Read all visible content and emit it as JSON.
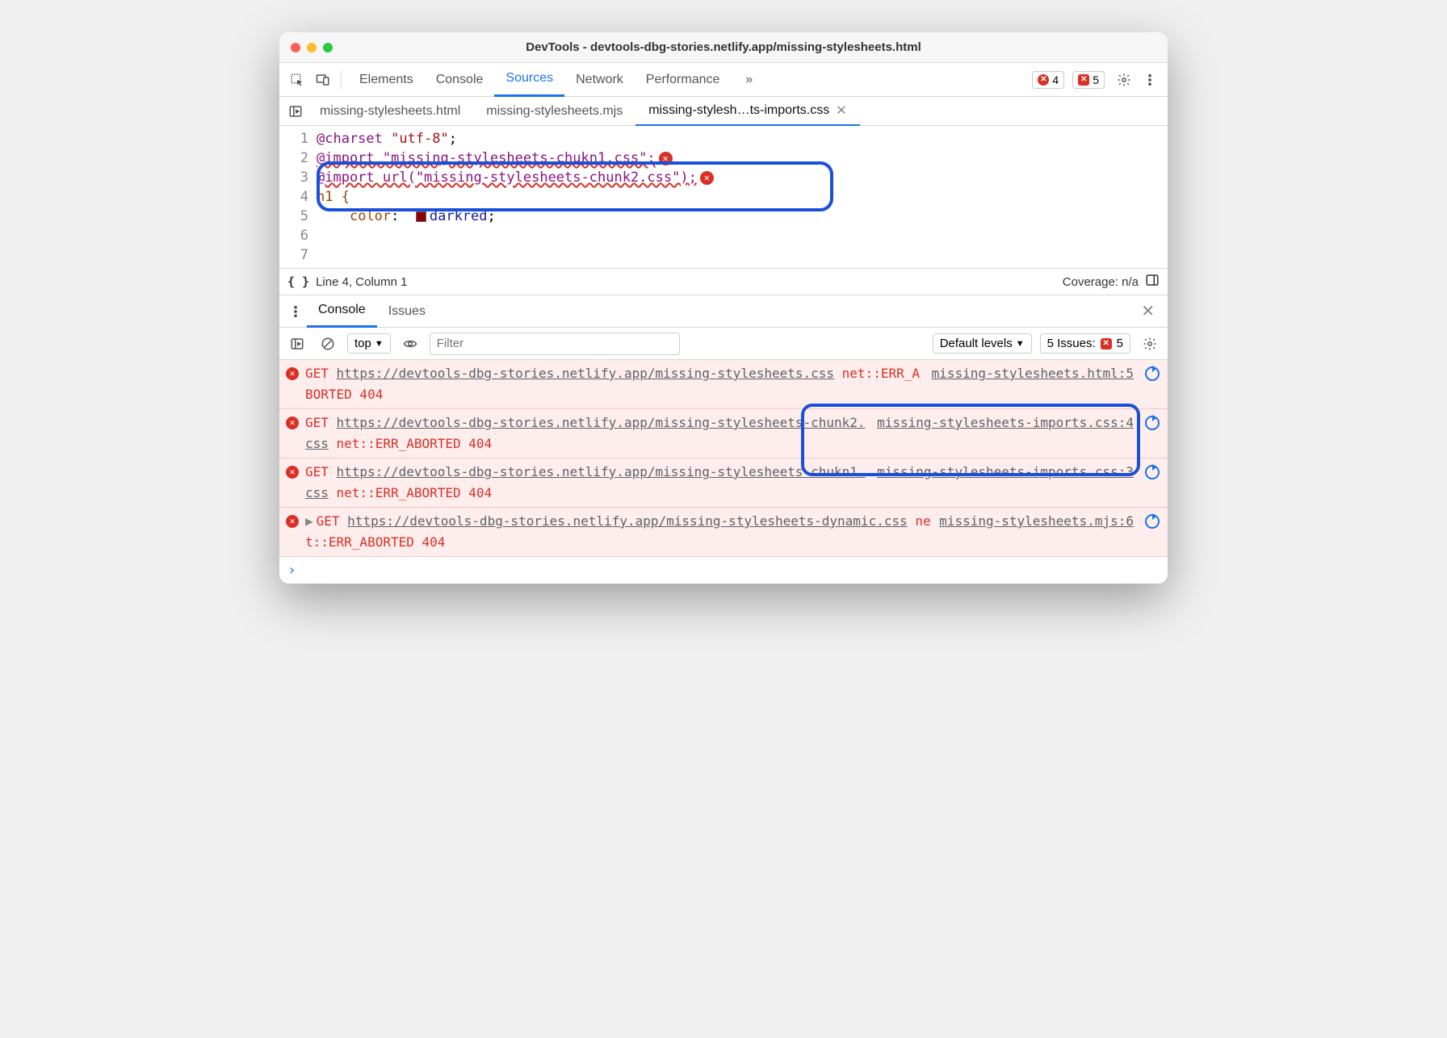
{
  "window": {
    "title": "DevTools - devtools-dbg-stories.netlify.app/missing-stylesheets.html"
  },
  "toolbar": {
    "tabs": [
      "Elements",
      "Console",
      "Sources",
      "Network",
      "Performance"
    ],
    "active_tab": "Sources",
    "more": "»",
    "error_count": "4",
    "warning_count": "5"
  },
  "file_tabs": {
    "tabs": [
      "missing-stylesheets.html",
      "missing-stylesheets.mjs",
      "missing-stylesh…ts-imports.css"
    ],
    "active": 2
  },
  "editor": {
    "lines": [
      {
        "n": "1",
        "segments": [
          {
            "t": "@charset ",
            "c": "kw"
          },
          {
            "t": "\"utf-8\"",
            "c": "str"
          },
          {
            "t": ";",
            "c": ""
          }
        ]
      },
      {
        "n": "2",
        "segments": []
      },
      {
        "n": "3",
        "segments": [
          {
            "t": "@import \"missing-stylesheets-chukn1.css\";",
            "c": "kw wavy"
          }
        ],
        "err": true
      },
      {
        "n": "4",
        "segments": [
          {
            "t": "@import url(\"missing-stylesheets-chunk2.css\");",
            "c": "kw wavy"
          }
        ],
        "err": true
      },
      {
        "n": "5",
        "segments": []
      },
      {
        "n": "6",
        "segments": [
          {
            "t": "h1 {",
            "c": "prop"
          }
        ]
      },
      {
        "n": "7",
        "segments": [
          {
            "t": "    ",
            "c": ""
          },
          {
            "t": "color",
            "c": "prop"
          },
          {
            "t": ":  ",
            "c": ""
          },
          {
            "t": "[sw]",
            "c": "swatch-marker"
          },
          {
            "t": "darkred",
            "c": "val"
          },
          {
            "t": ";",
            "c": ""
          }
        ]
      }
    ]
  },
  "status": {
    "cursor": "Line 4, Column 1",
    "coverage": "Coverage: n/a"
  },
  "drawer": {
    "tabs": [
      "Console",
      "Issues"
    ],
    "active": 0
  },
  "console_toolbar": {
    "context": "top",
    "filter_placeholder": "Filter",
    "levels": "Default levels",
    "issues_label": "5 Issues:",
    "issues_count": "5"
  },
  "messages": [
    {
      "text_parts": [
        "GET ",
        "https://devtools-dbg-stories.netlify.app/missing-stylesheets.css",
        " net::ERR_ABORTED 404"
      ],
      "source": "missing-stylesheets.html:5",
      "expandable": false
    },
    {
      "text_parts": [
        "GET ",
        "https://devtools-dbg-stories.netlify.app/missing-stylesheets-chunk2.css",
        " net::ERR_ABORTED 404"
      ],
      "source": "missing-stylesheets-imports.css:4",
      "expandable": false
    },
    {
      "text_parts": [
        "GET ",
        "https://devtools-dbg-stories.netlify.app/missing-stylesheets-chukn1.css",
        " net::ERR_ABORTED 404"
      ],
      "source": "missing-stylesheets-imports.css:3",
      "expandable": false
    },
    {
      "text_parts": [
        "GET ",
        "https://devtools-dbg-stories.netlify.app/missing-stylesheets-dynamic.css",
        " net::ERR_ABORTED 404"
      ],
      "source": "missing-stylesheets.mjs:6",
      "expandable": true
    }
  ]
}
